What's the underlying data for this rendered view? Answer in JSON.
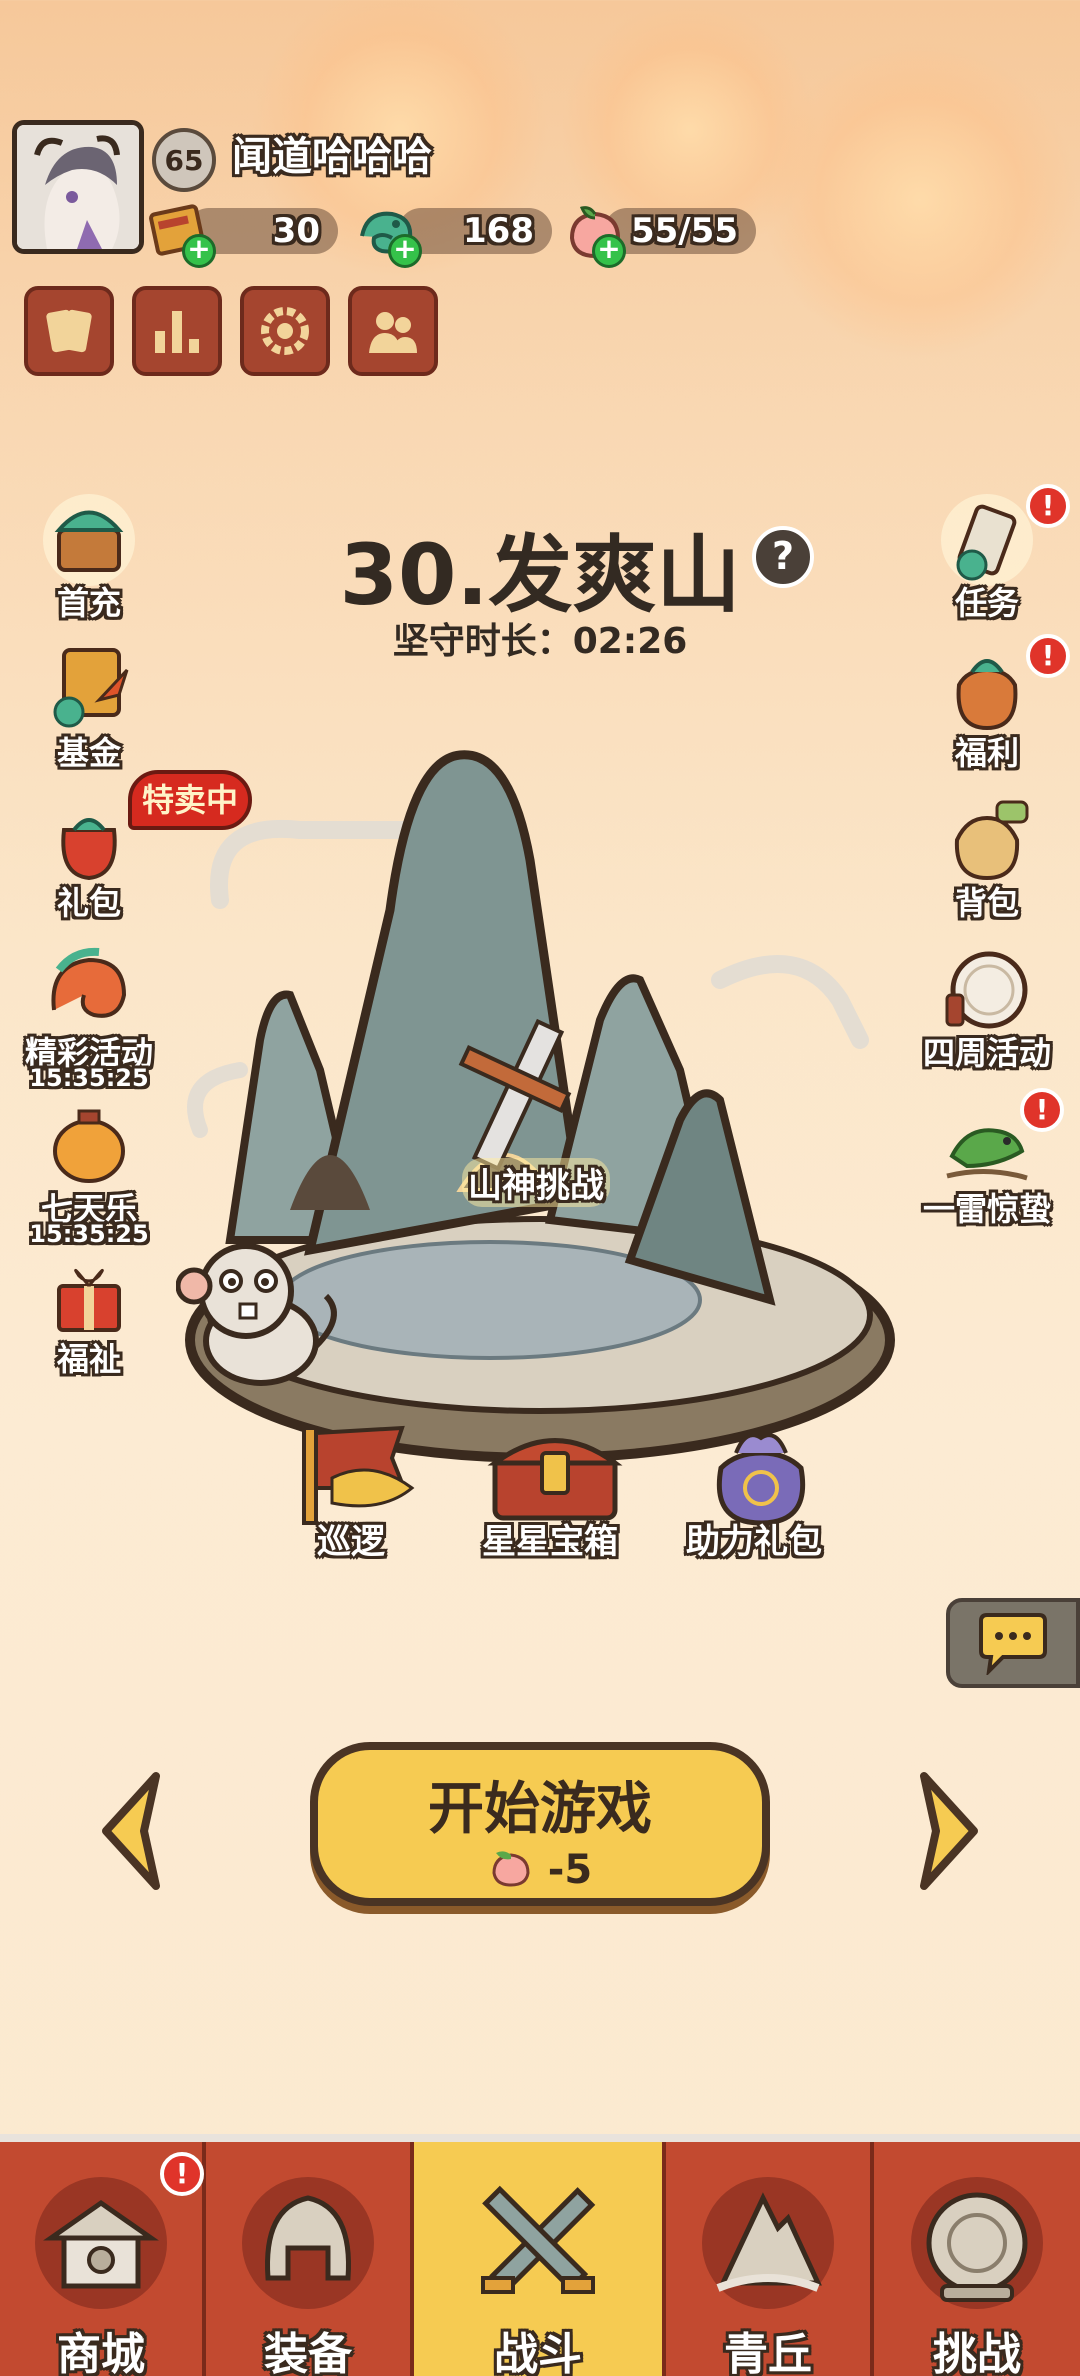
{
  "player": {
    "level": "65",
    "name": "闻道哈哈哈"
  },
  "resources": {
    "coupons": "30",
    "jade": "168",
    "stamina": "55/55"
  },
  "stage": {
    "title": "30.发爽山",
    "hold_time_label": "坚守时长：02:26",
    "help": "?"
  },
  "left_menu": [
    {
      "label": "首充"
    },
    {
      "label": "基金"
    },
    {
      "label": "礼包",
      "badge": "特卖中"
    },
    {
      "label": "精彩活动",
      "timer": "15:35:25"
    },
    {
      "label": "七天乐",
      "timer": "15:35:25"
    },
    {
      "label": "福祉"
    }
  ],
  "right_menu": [
    {
      "label": "任务",
      "alert": "!"
    },
    {
      "label": "福利",
      "alert": "!"
    },
    {
      "label": "背包"
    },
    {
      "label": "四周活动"
    },
    {
      "label": "一雷惊蛰",
      "alert": "!"
    }
  ],
  "map_items": {
    "challenge": "山神挑战",
    "patrol": "巡逻",
    "star_chest": "星星宝箱",
    "assist_pack": "助力礼包"
  },
  "start": {
    "label": "开始游戏",
    "cost": "-5"
  },
  "nav": [
    {
      "label": "商城",
      "alert": "!"
    },
    {
      "label": "装备"
    },
    {
      "label": "战斗"
    },
    {
      "label": "青丘"
    },
    {
      "label": "挑战"
    }
  ],
  "colors": {
    "accent_red": "#c24a30",
    "active_tab": "#f6cb52",
    "dark_outline": "#3a2a1e"
  }
}
